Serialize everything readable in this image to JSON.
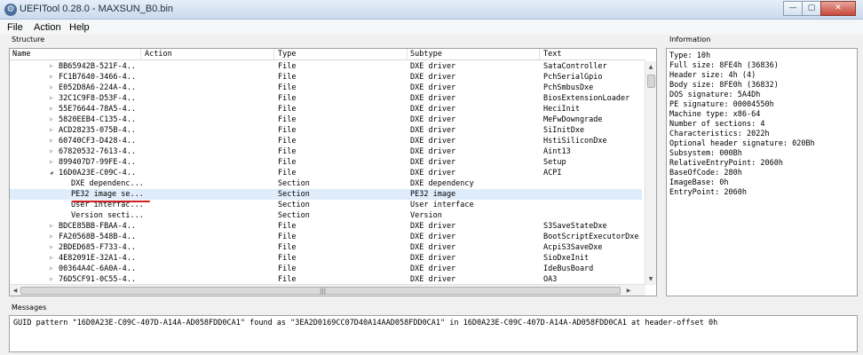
{
  "window": {
    "title": "UEFITool 0.28.0 - MAXSUN_B0.bin",
    "controls": {
      "minimize": "—",
      "maximize": "▢",
      "close": "✕"
    }
  },
  "menu": [
    "File",
    "Action",
    "Help"
  ],
  "structure": {
    "label": "Structure",
    "columns": [
      "Name",
      "Action",
      "Type",
      "Subtype",
      "Text"
    ],
    "rows": [
      {
        "name": "BB65942B-521F-4...",
        "action": "",
        "type": "File",
        "subtype": "DXE driver",
        "text": "SataController",
        "indent": 1,
        "expander": "▷"
      },
      {
        "name": "FC1B7640-3466-4...",
        "action": "",
        "type": "File",
        "subtype": "DXE driver",
        "text": "PchSerialGpio",
        "indent": 1,
        "expander": "▷"
      },
      {
        "name": "E052D8A6-224A-4...",
        "action": "",
        "type": "File",
        "subtype": "DXE driver",
        "text": "PchSmbusDxe",
        "indent": 1,
        "expander": "▷"
      },
      {
        "name": "32C1C9F8-D53F-4...",
        "action": "",
        "type": "File",
        "subtype": "DXE driver",
        "text": "BiosExtensionLoader",
        "indent": 1,
        "expander": "▷"
      },
      {
        "name": "55E76644-78A5-4...",
        "action": "",
        "type": "File",
        "subtype": "DXE driver",
        "text": "HeciInit",
        "indent": 1,
        "expander": "▷"
      },
      {
        "name": "5820EEB4-C135-4...",
        "action": "",
        "type": "File",
        "subtype": "DXE driver",
        "text": "MeFwDowngrade",
        "indent": 1,
        "expander": "▷"
      },
      {
        "name": "ACD28235-075B-4...",
        "action": "",
        "type": "File",
        "subtype": "DXE driver",
        "text": "SiInitDxe",
        "indent": 1,
        "expander": "▷"
      },
      {
        "name": "60740CF3-D428-4...",
        "action": "",
        "type": "File",
        "subtype": "DXE driver",
        "text": "HstiSiliconDxe",
        "indent": 1,
        "expander": "▷"
      },
      {
        "name": "67820532-7613-4...",
        "action": "",
        "type": "File",
        "subtype": "DXE driver",
        "text": "Aint13",
        "indent": 1,
        "expander": "▷"
      },
      {
        "name": "899407D7-99FE-4...",
        "action": "",
        "type": "File",
        "subtype": "DXE driver",
        "text": "Setup",
        "indent": 1,
        "expander": "▷"
      },
      {
        "name": "16D0A23E-C09C-4...",
        "action": "",
        "type": "File",
        "subtype": "DXE driver",
        "text": "ACPI",
        "indent": 1,
        "expander": "◢"
      },
      {
        "name": "DXE dependenc...",
        "action": "",
        "type": "Section",
        "subtype": "DXE dependency",
        "text": "",
        "indent": 2,
        "expander": ""
      },
      {
        "name": "PE32 image se...",
        "action": "",
        "type": "Section",
        "subtype": "PE32 image",
        "text": "",
        "indent": 2,
        "expander": "",
        "selected": true
      },
      {
        "name": "User interfac...",
        "action": "",
        "type": "Section",
        "subtype": "User interface",
        "text": "",
        "indent": 2,
        "expander": ""
      },
      {
        "name": "Version secti...",
        "action": "",
        "type": "Section",
        "subtype": "Version",
        "text": "",
        "indent": 2,
        "expander": ""
      },
      {
        "name": "BDCE85BB-FBAA-4...",
        "action": "",
        "type": "File",
        "subtype": "DXE driver",
        "text": "S3SaveStateDxe",
        "indent": 1,
        "expander": "▷"
      },
      {
        "name": "FA20568B-548B-4...",
        "action": "",
        "type": "File",
        "subtype": "DXE driver",
        "text": "BootScriptExecutorDxe",
        "indent": 1,
        "expander": "▷"
      },
      {
        "name": "2BDED685-F733-4...",
        "action": "",
        "type": "File",
        "subtype": "DXE driver",
        "text": "AcpiS3SaveDxe",
        "indent": 1,
        "expander": "▷"
      },
      {
        "name": "4E82091E-32A1-4...",
        "action": "",
        "type": "File",
        "subtype": "DXE driver",
        "text": "SioDxeInit",
        "indent": 1,
        "expander": "▷"
      },
      {
        "name": "00364A4C-6A0A-4...",
        "action": "",
        "type": "File",
        "subtype": "DXE driver",
        "text": "IdeBusBoard",
        "indent": 1,
        "expander": "▷"
      },
      {
        "name": "76D5CF91-0C55-4...",
        "action": "",
        "type": "File",
        "subtype": "DXE driver",
        "text": "OA3",
        "indent": 1,
        "expander": "▷"
      }
    ],
    "hscroll_grip": "|||"
  },
  "information": {
    "label": "Information",
    "lines": [
      "Type: 10h",
      "Full size: 8FE4h (36836)",
      "Header size: 4h (4)",
      "Body size: 8FE0h (36832)",
      "DOS signature: 5A4Dh",
      "PE signature: 00004550h",
      "Machine type: x86-64",
      "Number of sections: 4",
      "Characteristics: 2022h",
      "Optional header signature: 020Bh",
      "Subsystem: 000Bh",
      "RelativeEntryPoint: 2060h",
      "BaseOfCode: 280h",
      "ImageBase: 0h",
      "EntryPoint: 2060h"
    ]
  },
  "messages": {
    "label": "Messages",
    "lines": [
      "GUID pattern \"16D0A23E-C09C-407D-A14A-AD058FDD0CA1\" found as \"3EA2D0169CC07D40A14AAD058FDD0CA1\" in 16D0A23E-C09C-407D-A14A-AD058FDD0CA1 at header-offset 0h"
    ]
  },
  "colors": {
    "selection": "#dfecfb",
    "annotation": "#d21f1f",
    "title_gradient_top": "#e6eef8"
  }
}
